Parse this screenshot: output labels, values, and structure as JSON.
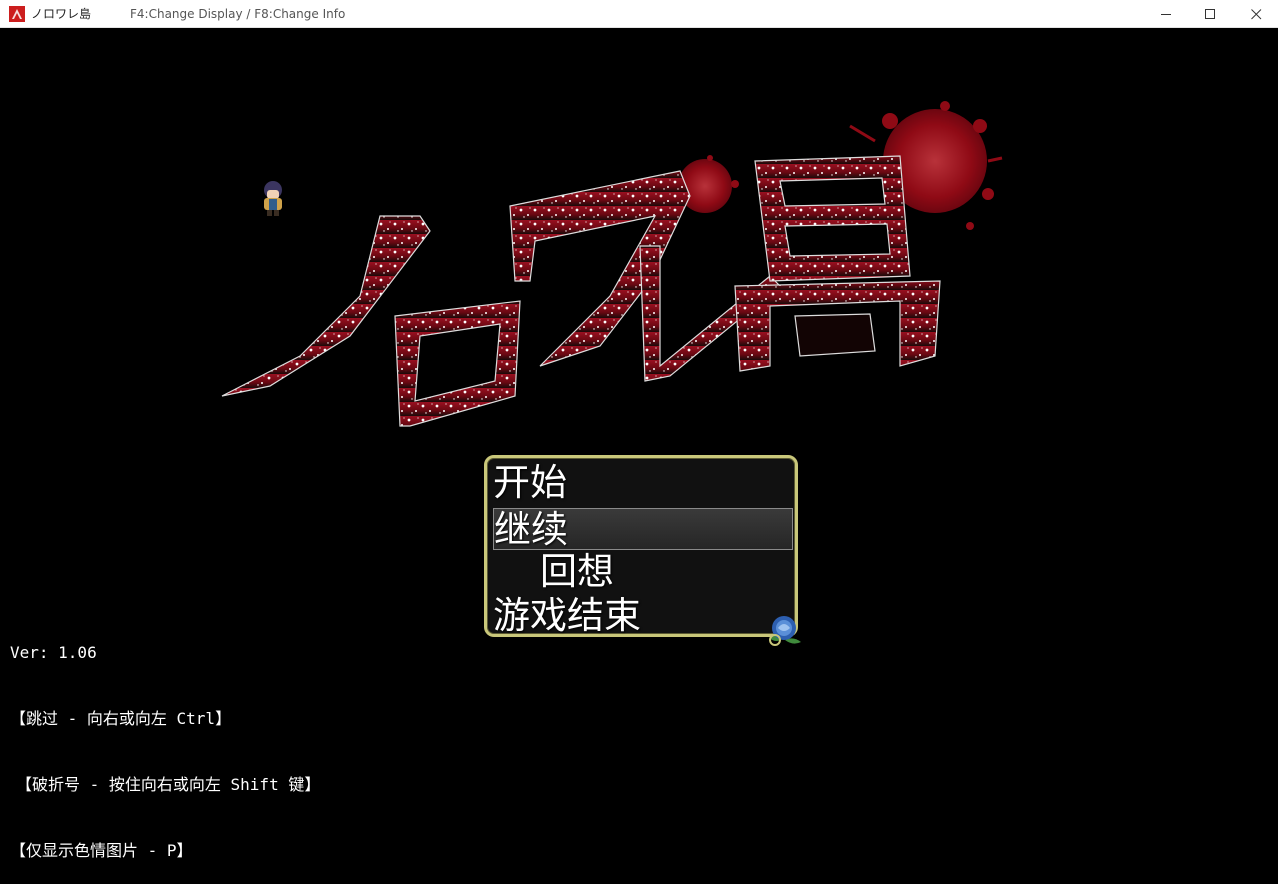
{
  "window": {
    "title": "ノロワレ島",
    "hint": "F4:Change Display / F8:Change Info",
    "minimize_label": "minimize",
    "maximize_label": "maximize",
    "close_label": "close"
  },
  "logo": {
    "text": "ノロワレ島"
  },
  "menu": {
    "items": [
      {
        "label": "开始"
      },
      {
        "label": "继续"
      },
      {
        "label": "回想"
      },
      {
        "label": "游戏结束"
      }
    ],
    "selected_index": 1
  },
  "info": {
    "version": "Ver: 1.06",
    "line_skip": "【跳过 - 向右或向左 Ctrl】",
    "line_break": "【破折号 - 按住向右或向左 Shift 键】",
    "line_only": "【仅显示色情图片 - P】"
  },
  "colors": {
    "background": "#000000",
    "menu_border": "#c9c77a",
    "logo_red": "#8b0d18",
    "blood": "#9c0a14"
  }
}
